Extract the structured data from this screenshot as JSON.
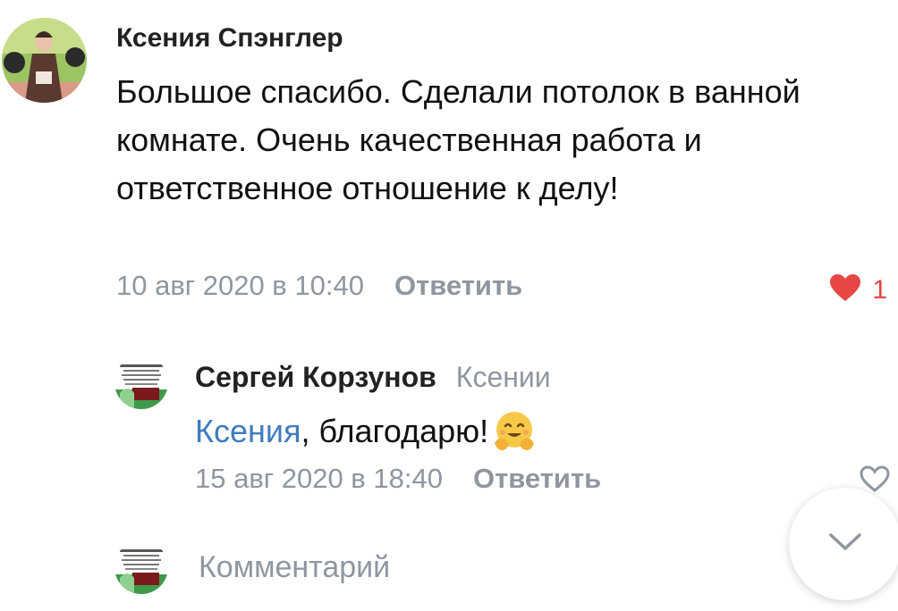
{
  "main_comment": {
    "author": "Ксения Спэнглер",
    "text": "Большое спасибо. Сделали потолок в ванной комнате. Очень качественная работа и ответственное отношение к делу!",
    "timestamp": "10 авг 2020 в 10:40",
    "reply_label": "Ответить",
    "like_count": "1",
    "liked": true,
    "accent_color": "#e64646"
  },
  "reply": {
    "author": "Сергей Корзунов",
    "reply_to": "Ксении",
    "mention": "Ксения",
    "text": ", благодарю!",
    "emoji": "hugging-face-emoji",
    "timestamp": "15 авг 2020 в 18:40",
    "reply_label": "Ответить",
    "liked": false,
    "mention_color": "#3f7cc0"
  },
  "composer": {
    "placeholder": "Комментарий"
  },
  "icons": {
    "like": "heart-icon",
    "scroll_down": "chevron-down-icon"
  }
}
